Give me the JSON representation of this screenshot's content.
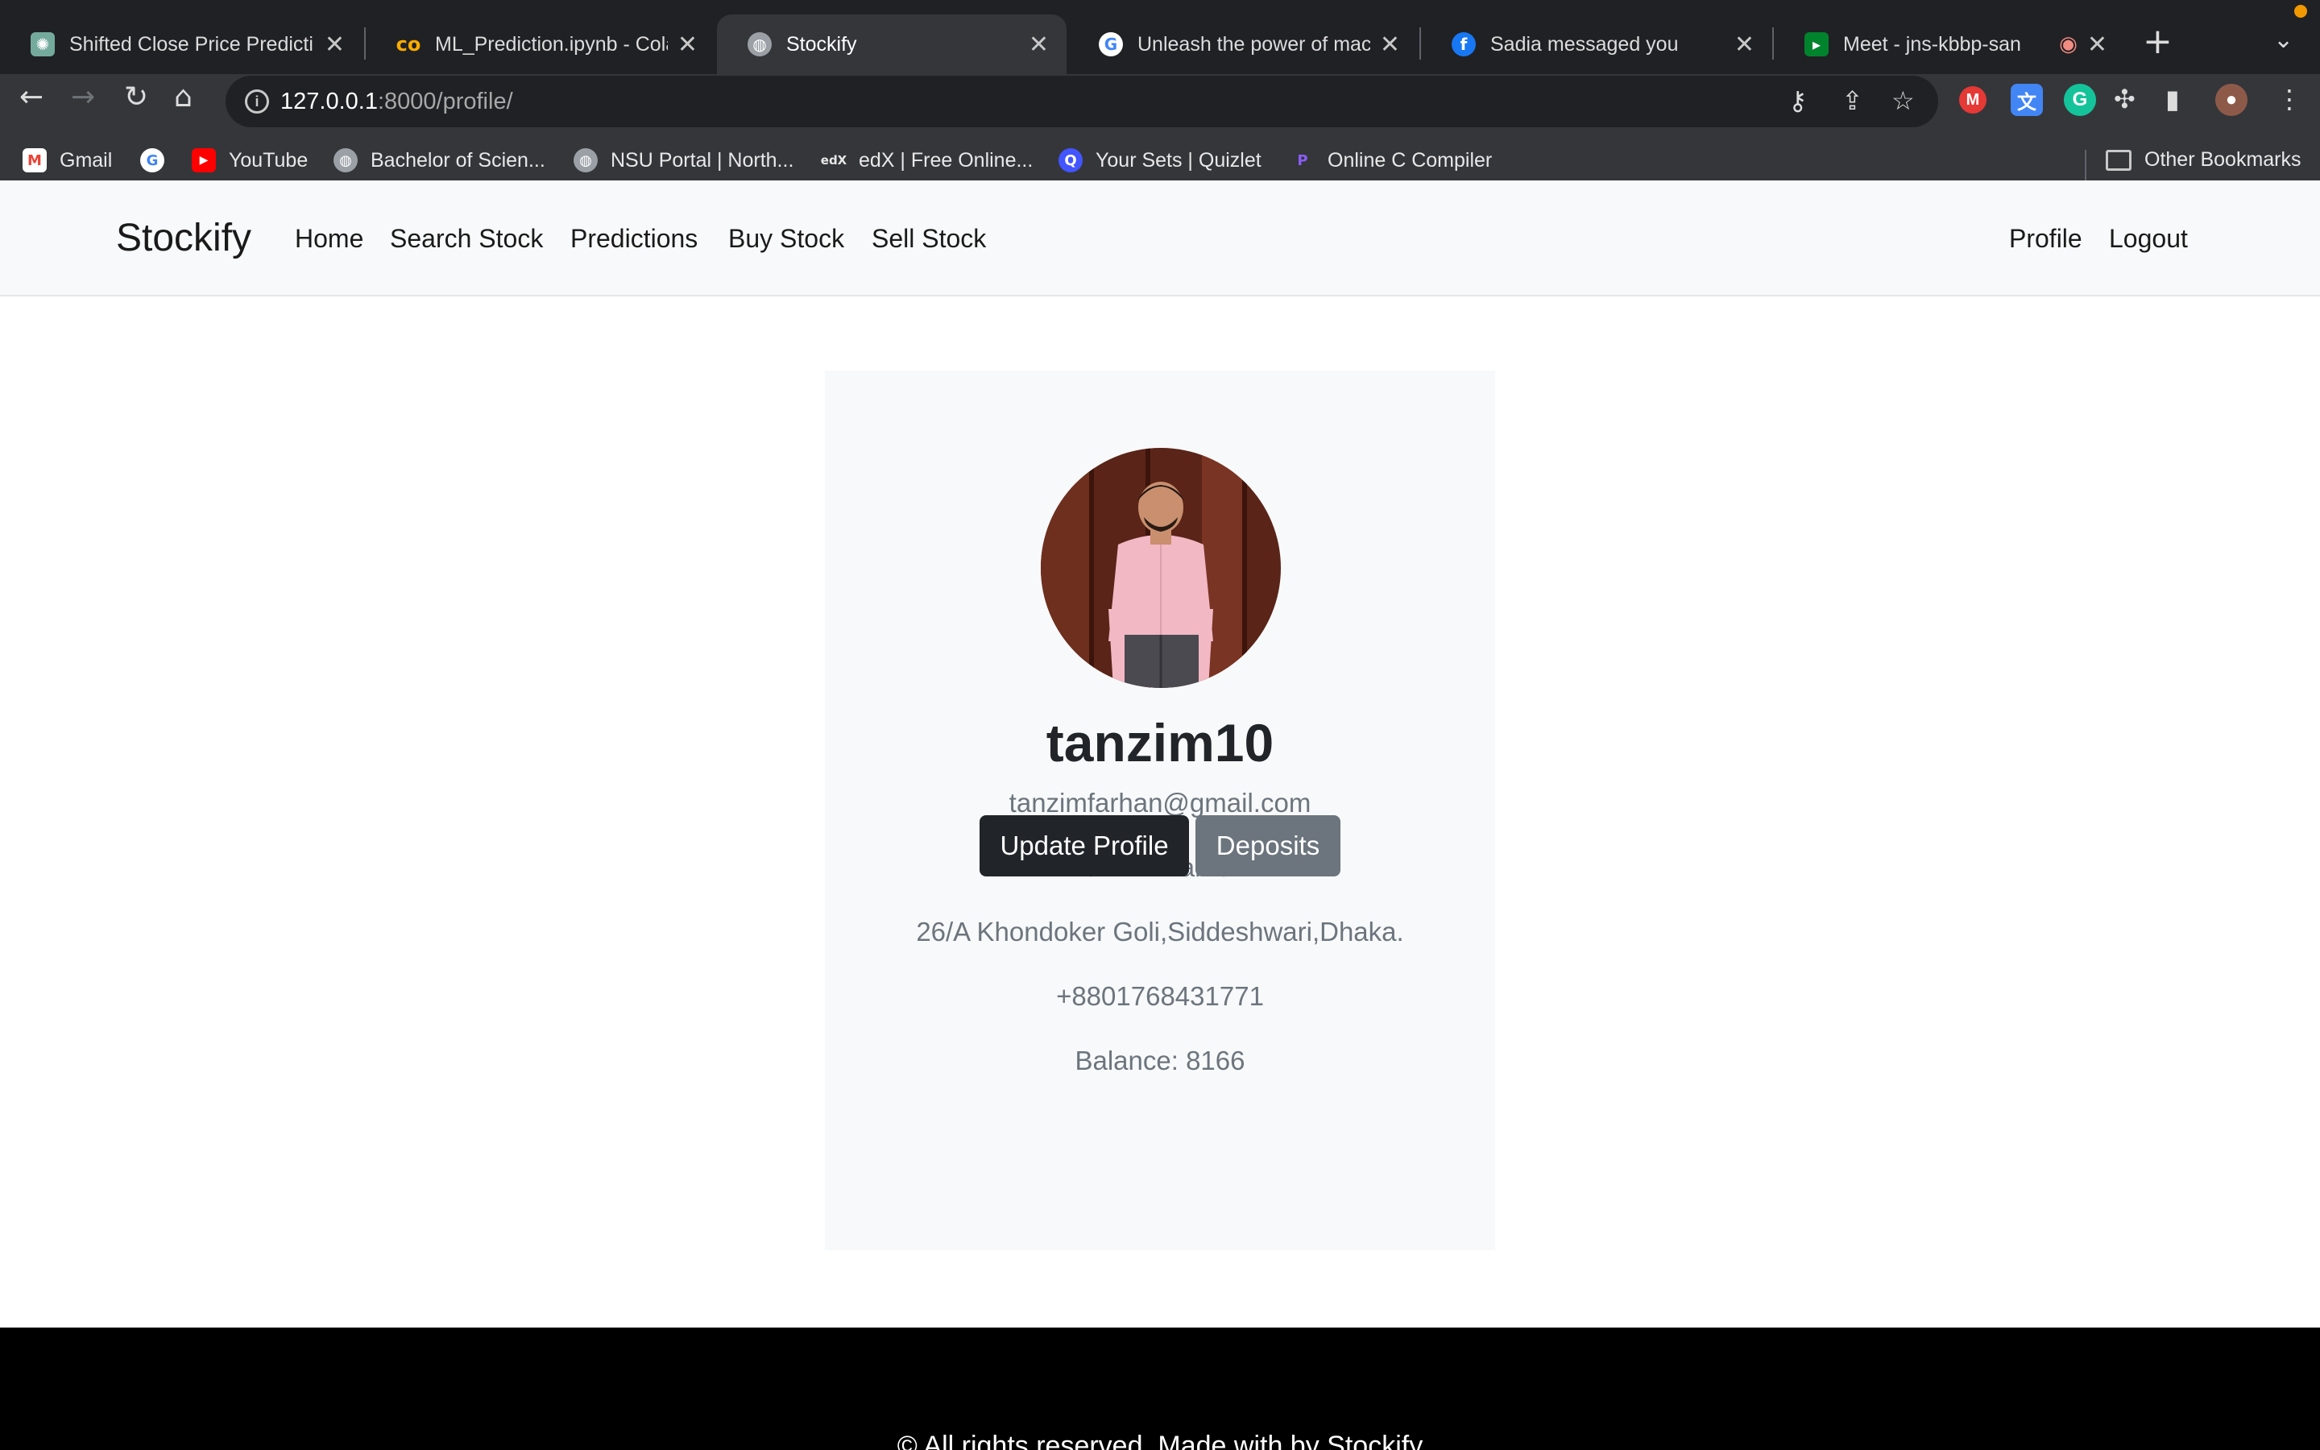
{
  "browser": {
    "tabs": [
      {
        "title": "Shifted Close Price Predicti",
        "icon": "chatgpt-icon",
        "color": "#74aa9c"
      },
      {
        "title": "ML_Prediction.ipynb - Cola",
        "icon": "colab-icon",
        "color": "#f9ab00"
      },
      {
        "title": "Stockify",
        "icon": "globe-icon",
        "color": "#9aa0a6"
      },
      {
        "title": "Unleash the power of mach",
        "icon": "google-icon",
        "color": "#4285f4"
      },
      {
        "title": "Sadia messaged you",
        "icon": "facebook-icon",
        "color": "#1877f2"
      },
      {
        "title": "Meet - jns-kbbp-san",
        "icon": "meet-icon",
        "color": "#00832d"
      }
    ],
    "url_host": "127.0.0.1",
    "url_rest": ":8000/profile/",
    "bookmarks": [
      {
        "label": "Gmail",
        "icon": "gmail-icon"
      },
      {
        "label": "",
        "icon": "google-icon"
      },
      {
        "label": "YouTube",
        "icon": "youtube-icon"
      },
      {
        "label": "Bachelor of Scien...",
        "icon": "globe-icon"
      },
      {
        "label": "NSU Portal | North...",
        "icon": "globe-icon"
      },
      {
        "label": "edX | Free Online...",
        "icon": "edx-icon"
      },
      {
        "label": "Your Sets | Quizlet",
        "icon": "quizlet-icon"
      },
      {
        "label": "Online C Compiler",
        "icon": "programiz-icon"
      }
    ],
    "other_bookmarks": "Other Bookmarks"
  },
  "site": {
    "brand": "Stockify",
    "nav": [
      "Home",
      "Search Stock",
      "Predictions",
      "Buy Stock",
      "Sell Stock"
    ],
    "nav_right": [
      "Profile",
      "Logout"
    ]
  },
  "profile": {
    "username": "tanzim10",
    "email": "tanzimfarhan@gmail.com",
    "full_name": "Tanzim Farhan",
    "address": "26/A Khondoker Goli,Siddeshwari,Dhaka.",
    "phone": "+8801768431771",
    "balance": "Balance: 8166",
    "update_button": "Update Profile",
    "deposits_button": "Deposits"
  },
  "footer": {
    "text": "© All rights reserved. Made with by Stockify"
  }
}
